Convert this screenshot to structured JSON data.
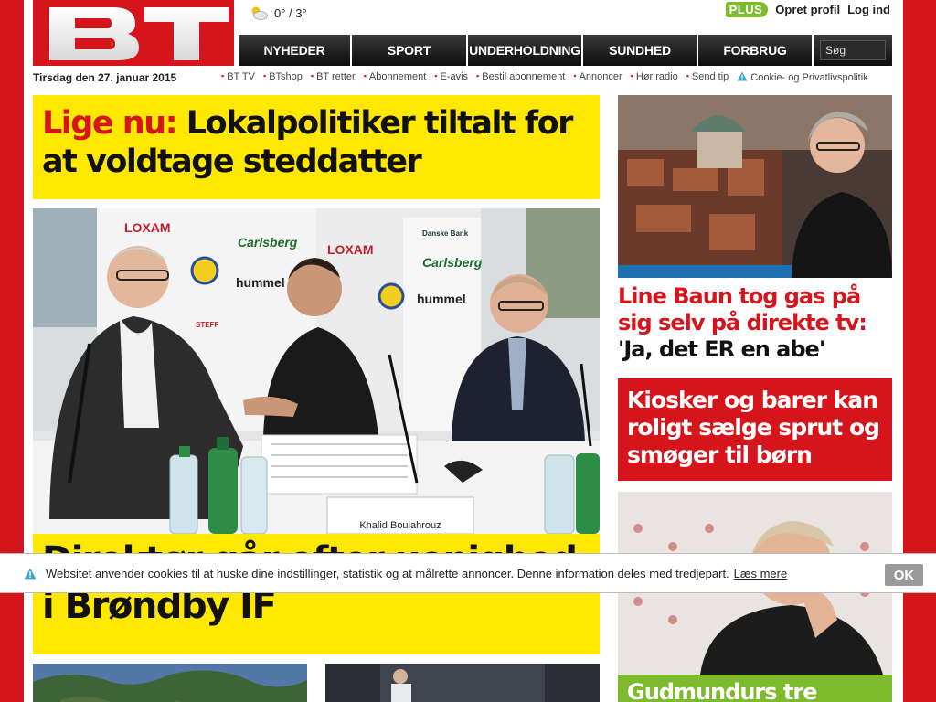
{
  "header": {
    "logo_text": "BT",
    "weather_temp": "0° / 3°",
    "plus_badge": "PLUS",
    "create_profile": "Opret profil",
    "login": "Log ind"
  },
  "nav": {
    "items": [
      "NYHEDER",
      "SPORT",
      "UNDERHOLDNING",
      "SUNDHED",
      "FORBRUG"
    ],
    "search_placeholder": "Søg"
  },
  "dateline": "Tirsdag den 27. januar 2015",
  "links": [
    "BT TV",
    "BTshop",
    "BT retter",
    "Abonnement",
    "E-avis",
    "Bestil abonnement",
    "Annoncer",
    "Hør radio",
    "Send tip"
  ],
  "cookie_link": "Cookie- og Privatlivspolitik",
  "lead_story": {
    "kicker": "Lige nu:",
    "headline": "Lokalpolitiker tiltalt for at voldtage steddatter"
  },
  "main_story": {
    "headline": "Direktør går efter uenighed i Brøndby IF",
    "photo_caption_nameplate": "Khalid Boulahrouz",
    "sponsors": [
      "LOXAM",
      "Carlsberg",
      "hummel",
      "Danske Bank",
      "STEFF"
    ]
  },
  "right_stories": [
    {
      "red": "Line Baun tog gas på sig selv på direkte tv:",
      "black": "'Ja, det ER en abe'"
    },
    {
      "text": "Kiosker og barer kan roligt sælge sprut og smøger til børn"
    },
    {
      "text": "Gudmundurs tre"
    }
  ],
  "cookie_bar": {
    "message": "Websitet anvender cookies til at huske dine indstillinger, statistik og at målrette annoncer. Denne information deles med tredjepart.",
    "more": "Læs mere",
    "ok": "OK"
  },
  "colors": {
    "brand_red": "#d6141b",
    "headline_yellow": "#ffe800",
    "plus_green": "#7dbb2c"
  }
}
